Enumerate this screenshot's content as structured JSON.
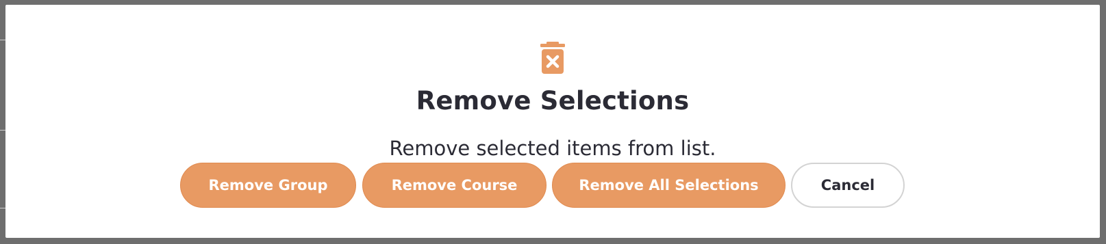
{
  "dialog": {
    "icon": "trash-x-icon",
    "accent_color": "#e89a63",
    "title": "Remove Selections",
    "message": "Remove selected items from list.",
    "buttons": {
      "remove_group": "Remove Group",
      "remove_course": "Remove Course",
      "remove_all": "Remove All Selections",
      "cancel": "Cancel"
    }
  }
}
